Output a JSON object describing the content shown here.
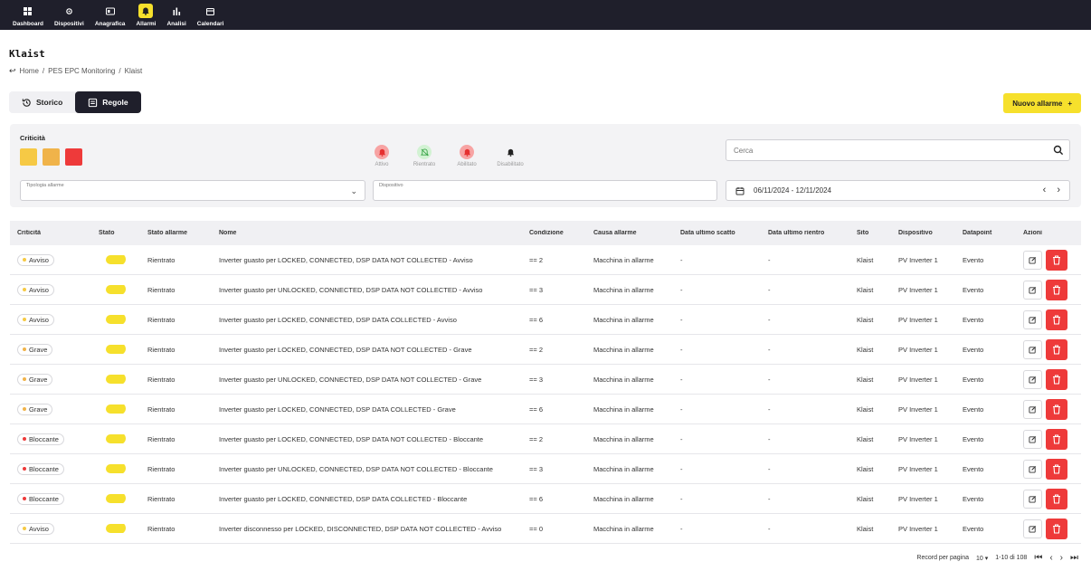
{
  "nav": {
    "items": [
      {
        "label": "Dashboard",
        "icon": "grid-icon"
      },
      {
        "label": "Dispositivi",
        "icon": "gear-icon"
      },
      {
        "label": "Anagrafica",
        "icon": "id-card-icon"
      },
      {
        "label": "Allarmi",
        "icon": "alarm-icon",
        "active": true
      },
      {
        "label": "Analisi",
        "icon": "bar-chart-icon"
      },
      {
        "label": "Calendari",
        "icon": "calendar-icon"
      }
    ]
  },
  "page": {
    "title": "Klaist",
    "breadcrumb": [
      "Home",
      "PES EPC Monitoring",
      "Klaist"
    ]
  },
  "tabs": [
    {
      "label": "Storico",
      "active": false
    },
    {
      "label": "Regole",
      "active": true
    }
  ],
  "new_button": {
    "label": "Nuovo allarme",
    "icon": "+"
  },
  "filters": {
    "criticita_label": "Criticità",
    "swatch_colors": [
      "#f6c945",
      "#f0b34a",
      "#ee3a3a"
    ],
    "status": [
      {
        "label": "Attivo",
        "color": "#f59a9a"
      },
      {
        "label": "Rientrato",
        "color": "#c7f0c9"
      },
      {
        "label": "Abilitato",
        "color": "#f59a9a"
      },
      {
        "label": "Disabilitato",
        "color": "transparent"
      }
    ],
    "search_placeholder": "Cerca",
    "tipologia_label": "Tipologia allarme",
    "dispositivo_label": "Dispositivo",
    "date_range": "06/11/2024 - 12/11/2024"
  },
  "table": {
    "headers": [
      "Criticità",
      "Stato",
      "Stato allarme",
      "Nome",
      "Condizione",
      "Causa allarme",
      "Data ultimo scatto",
      "Data ultimo rientro",
      "Sito",
      "Dispositivo",
      "Datapoint",
      "Azioni"
    ],
    "rows": [
      {
        "crit": "Avviso",
        "color": "#f6c945",
        "stato_allarme": "Rientrato",
        "nome": "Inverter guasto per LOCKED, CONNECTED, DSP DATA NOT COLLECTED - Avviso",
        "cond": "== 2",
        "causa": "Macchina in allarme",
        "dus": "-",
        "dur": "-",
        "sito": "Klaist",
        "disp": "PV Inverter 1",
        "dp": "Evento"
      },
      {
        "crit": "Avviso",
        "color": "#f6c945",
        "stato_allarme": "Rientrato",
        "nome": "Inverter guasto per UNLOCKED, CONNECTED, DSP DATA NOT COLLECTED - Avviso",
        "cond": "== 3",
        "causa": "Macchina in allarme",
        "dus": "-",
        "dur": "-",
        "sito": "Klaist",
        "disp": "PV Inverter 1",
        "dp": "Evento"
      },
      {
        "crit": "Avviso",
        "color": "#f6c945",
        "stato_allarme": "Rientrato",
        "nome": "Inverter guasto per LOCKED, CONNECTED, DSP DATA COLLECTED - Avviso",
        "cond": "== 6",
        "causa": "Macchina in allarme",
        "dus": "-",
        "dur": "-",
        "sito": "Klaist",
        "disp": "PV Inverter 1",
        "dp": "Evento"
      },
      {
        "crit": "Grave",
        "color": "#f0b34a",
        "stato_allarme": "Rientrato",
        "nome": "Inverter guasto per LOCKED, CONNECTED, DSP DATA NOT COLLECTED - Grave",
        "cond": "== 2",
        "causa": "Macchina in allarme",
        "dus": "-",
        "dur": "-",
        "sito": "Klaist",
        "disp": "PV Inverter 1",
        "dp": "Evento"
      },
      {
        "crit": "Grave",
        "color": "#f0b34a",
        "stato_allarme": "Rientrato",
        "nome": "Inverter guasto per UNLOCKED, CONNECTED, DSP DATA NOT COLLECTED - Grave",
        "cond": "== 3",
        "causa": "Macchina in allarme",
        "dus": "-",
        "dur": "-",
        "sito": "Klaist",
        "disp": "PV Inverter 1",
        "dp": "Evento"
      },
      {
        "crit": "Grave",
        "color": "#f0b34a",
        "stato_allarme": "Rientrato",
        "nome": "Inverter guasto per LOCKED, CONNECTED, DSP DATA COLLECTED - Grave",
        "cond": "== 6",
        "causa": "Macchina in allarme",
        "dus": "-",
        "dur": "-",
        "sito": "Klaist",
        "disp": "PV Inverter 1",
        "dp": "Evento"
      },
      {
        "crit": "Bloccante",
        "color": "#ee3a3a",
        "stato_allarme": "Rientrato",
        "nome": "Inverter guasto per LOCKED, CONNECTED, DSP DATA NOT COLLECTED - Bloccante",
        "cond": "== 2",
        "causa": "Macchina in allarme",
        "dus": "-",
        "dur": "-",
        "sito": "Klaist",
        "disp": "PV Inverter 1",
        "dp": "Evento"
      },
      {
        "crit": "Bloccante",
        "color": "#ee3a3a",
        "stato_allarme": "Rientrato",
        "nome": "Inverter guasto per UNLOCKED, CONNECTED, DSP DATA NOT COLLECTED - Bloccante",
        "cond": "== 3",
        "causa": "Macchina in allarme",
        "dus": "-",
        "dur": "-",
        "sito": "Klaist",
        "disp": "PV Inverter 1",
        "dp": "Evento"
      },
      {
        "crit": "Bloccante",
        "color": "#ee3a3a",
        "stato_allarme": "Rientrato",
        "nome": "Inverter guasto per LOCKED, CONNECTED, DSP DATA COLLECTED - Bloccante",
        "cond": "== 6",
        "causa": "Macchina in allarme",
        "dus": "-",
        "dur": "-",
        "sito": "Klaist",
        "disp": "PV Inverter 1",
        "dp": "Evento"
      },
      {
        "crit": "Avviso",
        "color": "#f6c945",
        "stato_allarme": "Rientrato",
        "nome": "Inverter disconnesso per LOCKED, DISCONNECTED, DSP DATA NOT COLLECTED - Avviso",
        "cond": "== 0",
        "causa": "Macchina in allarme",
        "dus": "-",
        "dur": "-",
        "sito": "Klaist",
        "disp": "PV Inverter 1",
        "dp": "Evento"
      }
    ]
  },
  "pagination": {
    "label": "Record per pagina",
    "per_page": "10",
    "range": "1-10 di 108"
  }
}
